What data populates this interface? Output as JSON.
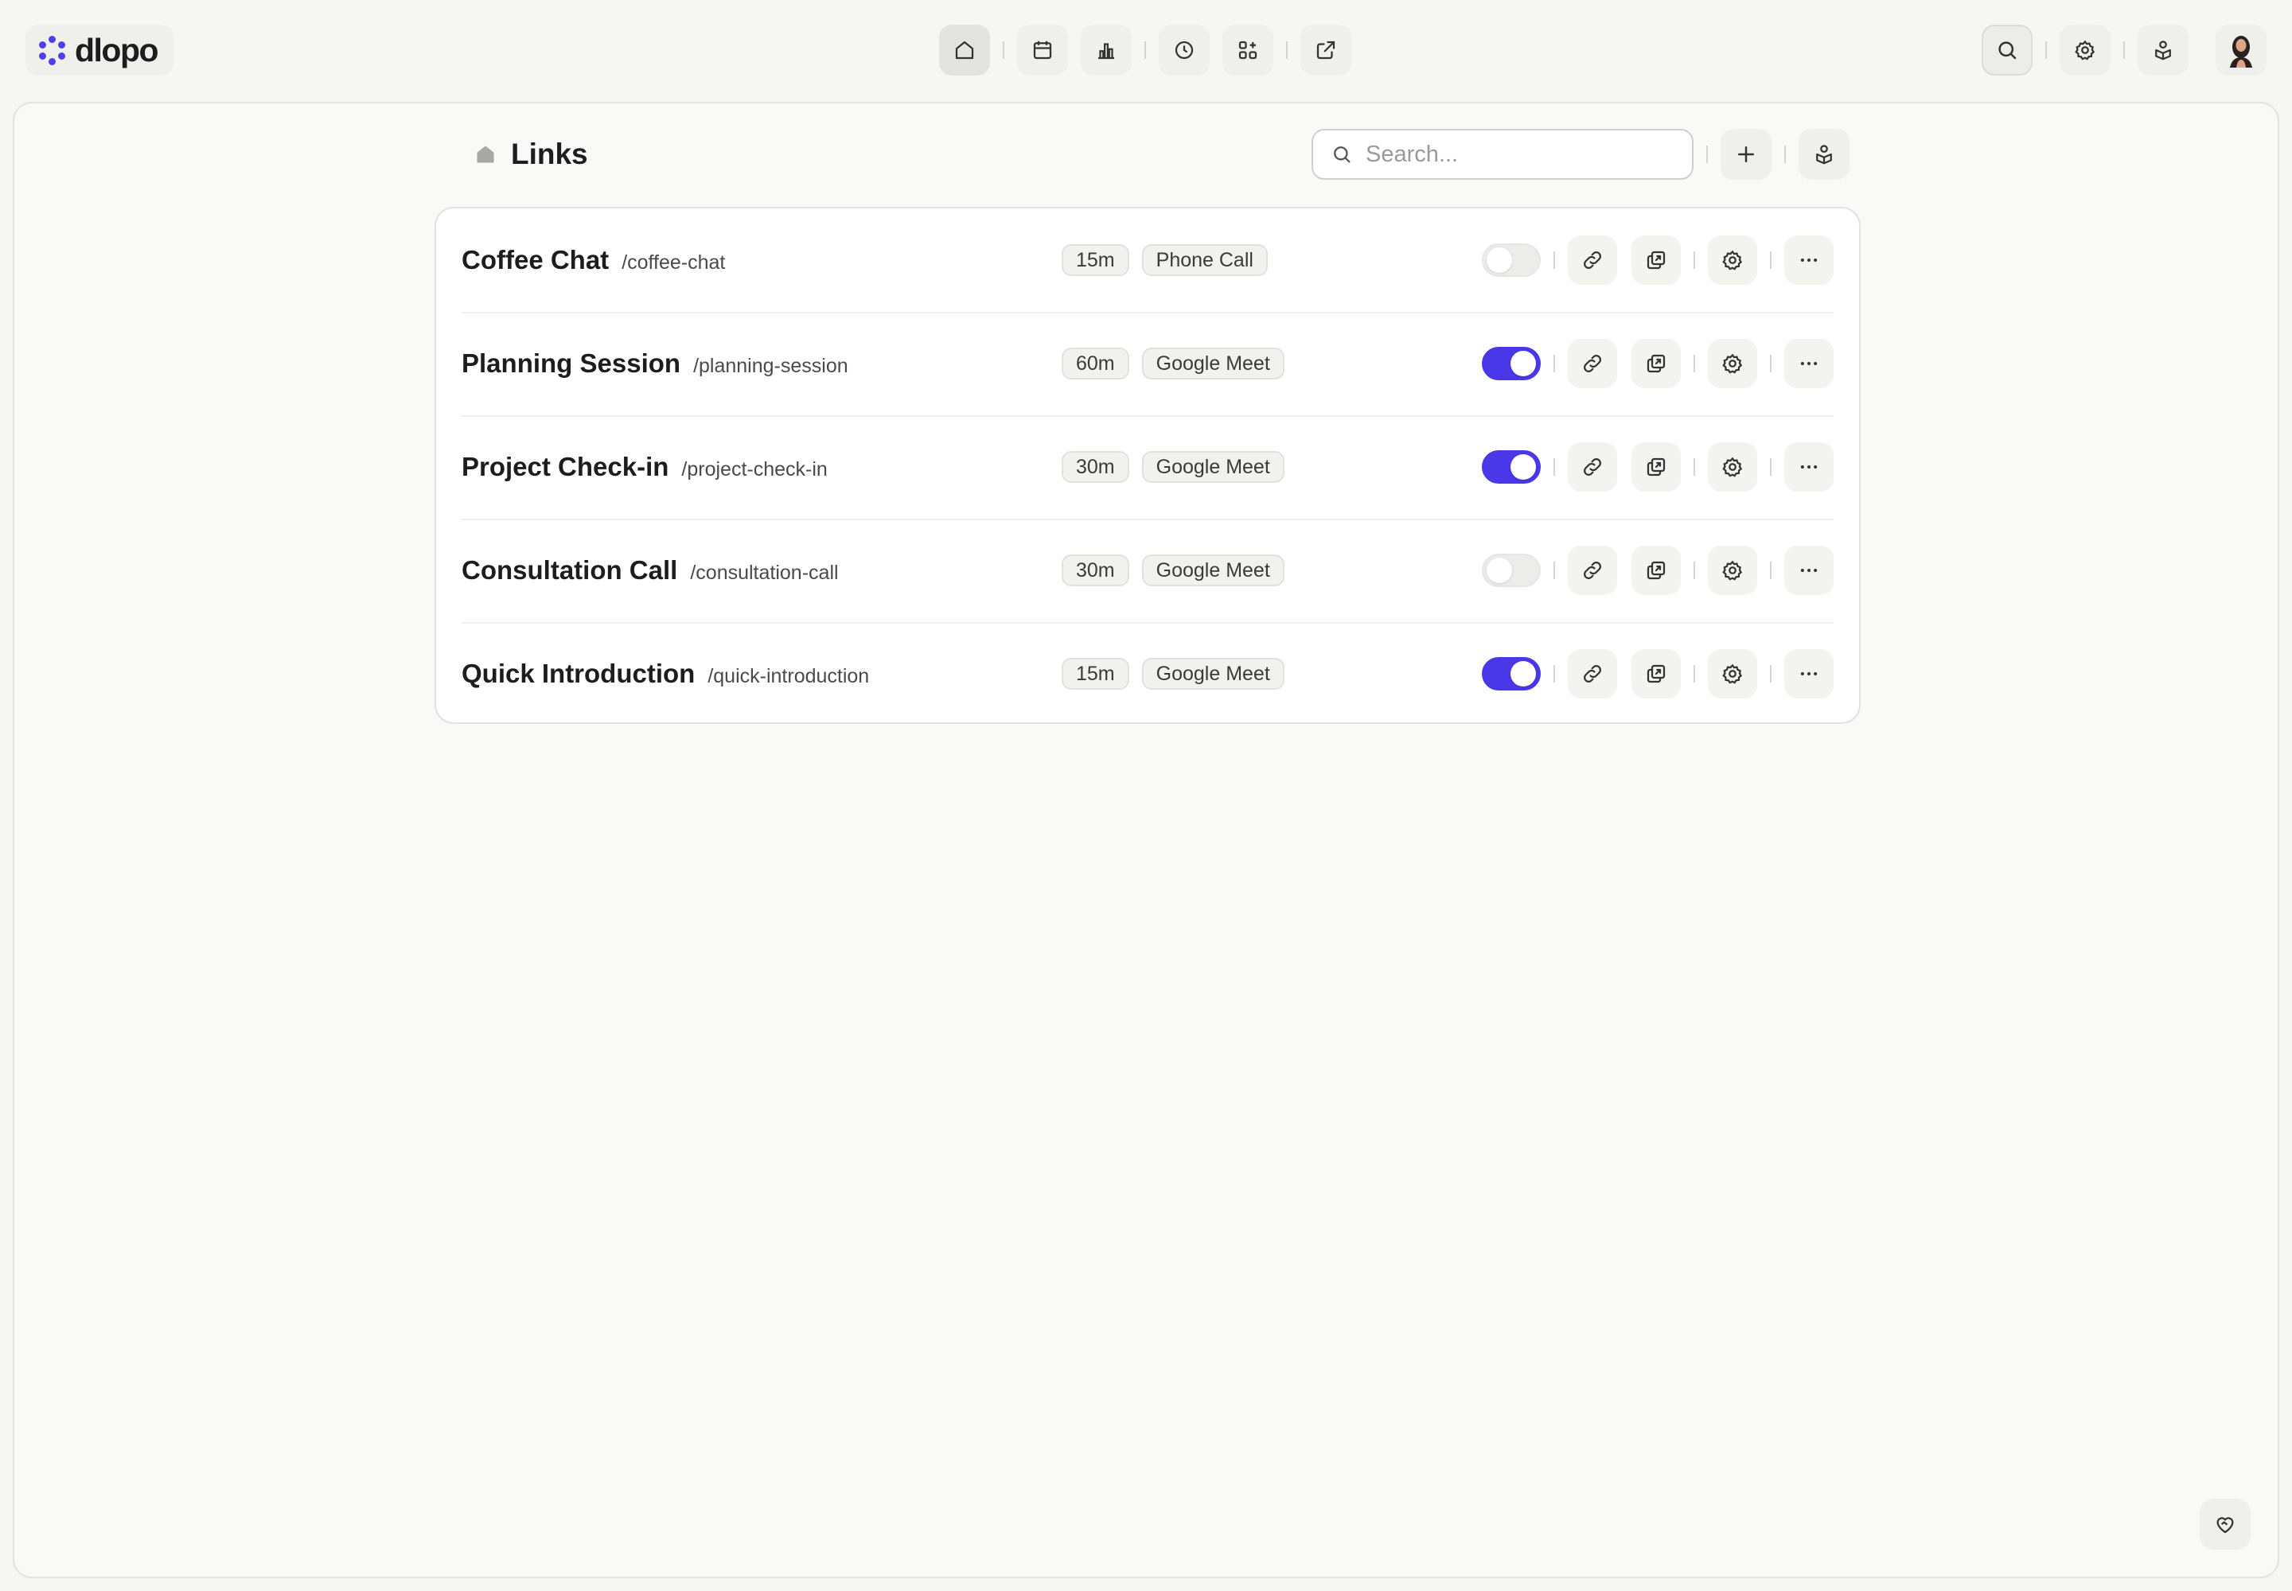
{
  "app": {
    "name": "dlopo"
  },
  "nav": {
    "items": [
      {
        "id": "home",
        "icon": "home-icon",
        "active": true
      },
      {
        "id": "calendar",
        "icon": "calendar-icon",
        "active": false
      },
      {
        "id": "analytics",
        "icon": "bar-chart-icon",
        "active": false
      },
      {
        "id": "availability",
        "icon": "clock-icon",
        "active": false
      },
      {
        "id": "apps",
        "icon": "apps-add-icon",
        "active": false
      },
      {
        "id": "external",
        "icon": "external-link-icon",
        "active": false
      }
    ]
  },
  "top_right": {
    "icons": [
      "search-icon",
      "gear-icon",
      "embed-icon",
      "avatar"
    ]
  },
  "page": {
    "title": "Links",
    "search_placeholder": "Search..."
  },
  "links": [
    {
      "title": "Coffee Chat",
      "slug": "/coffee-chat",
      "duration": "15m",
      "location": "Phone Call",
      "enabled": false
    },
    {
      "title": "Planning Session",
      "slug": "/planning-session",
      "duration": "60m",
      "location": "Google Meet",
      "enabled": true
    },
    {
      "title": "Project Check-in",
      "slug": "/project-check-in",
      "duration": "30m",
      "location": "Google Meet",
      "enabled": true
    },
    {
      "title": "Consultation Call",
      "slug": "/consultation-call",
      "duration": "30m",
      "location": "Google Meet",
      "enabled": false
    },
    {
      "title": "Quick Introduction",
      "slug": "/quick-introduction",
      "duration": "15m",
      "location": "Google Meet",
      "enabled": true
    }
  ],
  "colors": {
    "accent": "#4a38e8",
    "brand": "#4f3ff0",
    "background": "#f6f6f4",
    "card": "#ffffff"
  }
}
